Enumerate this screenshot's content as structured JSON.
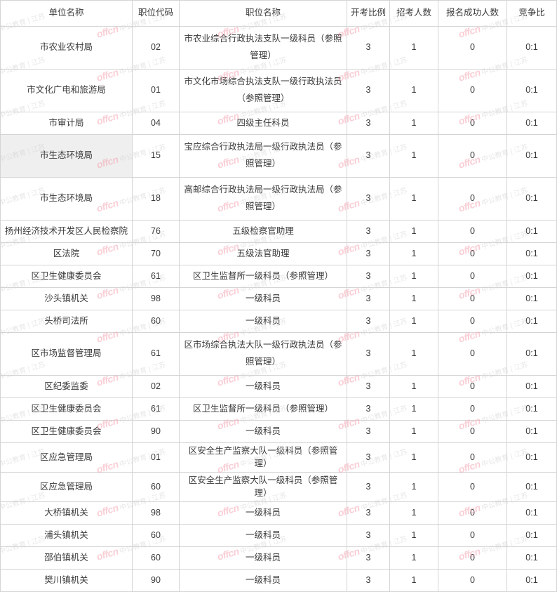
{
  "table": {
    "name": "job-position-statistics-table",
    "columns": [
      {
        "key": "unit",
        "label": "单位名称"
      },
      {
        "key": "code",
        "label": "职位代码"
      },
      {
        "key": "title",
        "label": "职位名称"
      },
      {
        "key": "ratio",
        "label": "开考比例"
      },
      {
        "key": "hire",
        "label": "招考人数"
      },
      {
        "key": "signed",
        "label": "报名成功人数"
      },
      {
        "key": "comp",
        "label": "竞争比"
      }
    ],
    "rows": [
      {
        "unit": "市农业农村局",
        "code": "02",
        "title": "市农业综合行政执法支队一级科员（参照管理）",
        "ratio": "3",
        "hire": "1",
        "signed": "0",
        "comp": "0:1",
        "tall": true,
        "highlight_unit": false
      },
      {
        "unit": "市文化广电和旅游局",
        "code": "01",
        "title": "市文化市场综合执法支队一级行政执法员（参照管理）",
        "ratio": "3",
        "hire": "1",
        "signed": "0",
        "comp": "0:1",
        "tall": true,
        "highlight_unit": false
      },
      {
        "unit": "市审计局",
        "code": "04",
        "title": "四级主任科员",
        "ratio": "3",
        "hire": "1",
        "signed": "0",
        "comp": "0:1",
        "tall": false,
        "highlight_unit": false
      },
      {
        "unit": "市生态环境局",
        "code": "15",
        "title": "宝应综合行政执法局一级行政执法员（参照管理）",
        "ratio": "3",
        "hire": "1",
        "signed": "0",
        "comp": "0:1",
        "tall": true,
        "highlight_unit": true
      },
      {
        "unit": "市生态环境局",
        "code": "18",
        "title": "高邮综合行政执法局一级行政执法局（参照管理）",
        "ratio": "3",
        "hire": "1",
        "signed": "0",
        "comp": "0:1",
        "tall": true,
        "highlight_unit": false
      },
      {
        "unit": "扬州经济技术开发区人民检察院",
        "code": "76",
        "title": "五级检察官助理",
        "ratio": "3",
        "hire": "1",
        "signed": "0",
        "comp": "0:1",
        "tall": false,
        "highlight_unit": false
      },
      {
        "unit": "区法院",
        "code": "70",
        "title": "五级法官助理",
        "ratio": "3",
        "hire": "1",
        "signed": "0",
        "comp": "0:1",
        "tall": false,
        "highlight_unit": false
      },
      {
        "unit": "区卫生健康委员会",
        "code": "61",
        "title": "区卫生监督所一级科员（参照管理）",
        "ratio": "3",
        "hire": "1",
        "signed": "0",
        "comp": "0:1",
        "tall": false,
        "highlight_unit": false
      },
      {
        "unit": "沙头镇机关",
        "code": "98",
        "title": "一级科员",
        "ratio": "3",
        "hire": "1",
        "signed": "0",
        "comp": "0:1",
        "tall": false,
        "highlight_unit": false
      },
      {
        "unit": "头桥司法所",
        "code": "60",
        "title": "一级科员",
        "ratio": "3",
        "hire": "1",
        "signed": "0",
        "comp": "0:1",
        "tall": false,
        "highlight_unit": false
      },
      {
        "unit": "区市场监督管理局",
        "code": "61",
        "title": "区市场综合执法大队一级行政执法员（参照管理）",
        "ratio": "3",
        "hire": "1",
        "signed": "0",
        "comp": "0:1",
        "tall": true,
        "highlight_unit": false
      },
      {
        "unit": "区纪委监委",
        "code": "02",
        "title": "一级科员",
        "ratio": "3",
        "hire": "1",
        "signed": "0",
        "comp": "0:1",
        "tall": false,
        "highlight_unit": false
      },
      {
        "unit": "区卫生健康委员会",
        "code": "61",
        "title": "区卫生监督所一级科员（参照管理）",
        "ratio": "3",
        "hire": "1",
        "signed": "0",
        "comp": "0:1",
        "tall": false,
        "highlight_unit": false
      },
      {
        "unit": "区卫生健康委员会",
        "code": "90",
        "title": "一级科员",
        "ratio": "3",
        "hire": "1",
        "signed": "0",
        "comp": "0:1",
        "tall": false,
        "highlight_unit": false
      },
      {
        "unit": "区应急管理局",
        "code": "01",
        "title": "区安全生产监察大队一级科员（参照管理）",
        "ratio": "3",
        "hire": "1",
        "signed": "0",
        "comp": "0:1",
        "tall": false,
        "highlight_unit": false
      },
      {
        "unit": "区应急管理局",
        "code": "60",
        "title": "区安全生产监察大队一级科员（参照管理）",
        "ratio": "3",
        "hire": "1",
        "signed": "0",
        "comp": "0:1",
        "tall": false,
        "highlight_unit": false
      },
      {
        "unit": "大桥镇机关",
        "code": "98",
        "title": "一级科员",
        "ratio": "3",
        "hire": "1",
        "signed": "0",
        "comp": "0:1",
        "tall": false,
        "highlight_unit": false
      },
      {
        "unit": "浦头镇机关",
        "code": "60",
        "title": "一级科员",
        "ratio": "3",
        "hire": "1",
        "signed": "0",
        "comp": "0:1",
        "tall": false,
        "highlight_unit": false
      },
      {
        "unit": "邵伯镇机关",
        "code": "60",
        "title": "一级科员",
        "ratio": "3",
        "hire": "1",
        "signed": "0",
        "comp": "0:1",
        "tall": false,
        "highlight_unit": false
      },
      {
        "unit": "樊川镇机关",
        "code": "90",
        "title": "一级科员",
        "ratio": "3",
        "hire": "1",
        "signed": "0",
        "comp": "0:1",
        "tall": false,
        "highlight_unit": false
      }
    ]
  },
  "watermark": {
    "brand": "offcn",
    "text": "中公教育 | 江苏",
    "brand_color": "#f4a0ae",
    "text_color": "#cfcfcf"
  },
  "colors": {
    "border": "#d4d4d4",
    "text": "#3a3a3a",
    "highlight_row_bg": "#efefef",
    "page_bg": "#ffffff"
  }
}
